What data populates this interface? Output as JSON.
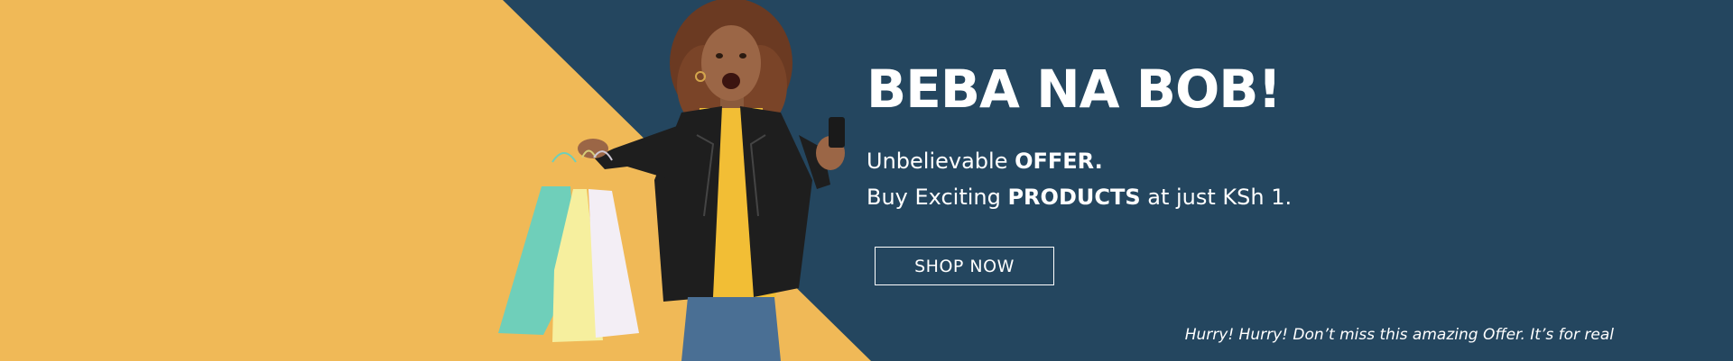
{
  "colors": {
    "background": "#24465f",
    "accent": "#f0b957",
    "text": "#ffffff"
  },
  "banner": {
    "headline": "BEBA NA BOB!",
    "subline_1_normal": "Unbelievable ",
    "subline_1_bold": "OFFER.",
    "subline_2_a": "Buy Exciting ",
    "subline_2_bold": "PRODUCTS",
    "subline_2_b": " at just KSh 1.",
    "shop_button_label": "SHOP NOW",
    "tagline": "Hurry! Hurry! Don’t miss this amazing Offer. It’s for real"
  },
  "icons": {
    "shopping_bags": "shopping-bags-icon",
    "phone": "phone-icon"
  }
}
